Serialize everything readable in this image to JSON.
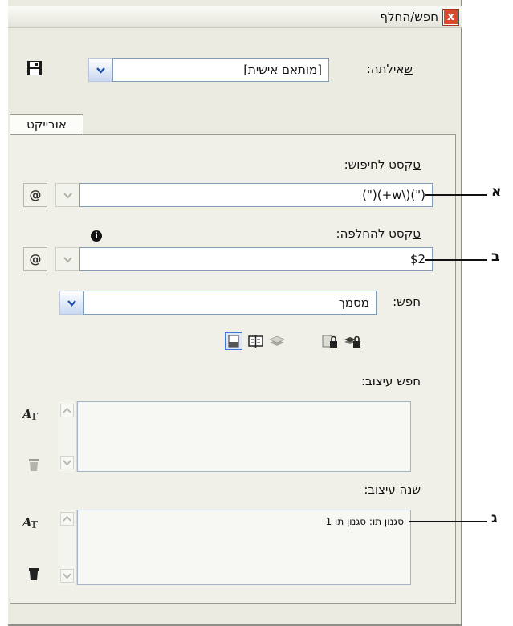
{
  "window": {
    "title": "חפש/החלף",
    "close_symbol": "x"
  },
  "query": {
    "label_prefix": "ש",
    "label_rest": "אילתה:",
    "value": "[מותאם אישית]"
  },
  "tabs": [
    {
      "label": "אובייקט"
    }
  ],
  "find_text": {
    "label_prefix": "ט",
    "label_rest": "קסט לחיפוש:",
    "value": "(\")(\\w+)(\")"
  },
  "replace_text": {
    "label_prefix": "ט",
    "label_rest": "קסט להחלפה:",
    "value": "$2"
  },
  "search_scope": {
    "label_prefix": "ח",
    "label_rest": "פש:",
    "value": "מסמך"
  },
  "find_format": {
    "label": "חפש עיצוב:"
  },
  "change_format": {
    "label": "שנה עיצוב:",
    "value": "סגנון תו: סגנון תו 1"
  },
  "special_char_symbol": "@",
  "info_symbol": "i",
  "callouts": {
    "a": "א",
    "b": "ב",
    "c": "ג"
  },
  "colors": {
    "accent_blue": "#3b78d8",
    "close_red": "#d84a2e",
    "panel_bg": "#ecebe1"
  },
  "icons": {
    "save": "floppy-disk-icon",
    "toolbar": [
      "locked-layers-icon",
      "locked-stories-icon",
      "layers-icon",
      "footnotes-icon",
      "master-pages-icon"
    ],
    "format_find": "specify-attributes-icon",
    "format_clear": "trash-icon"
  }
}
